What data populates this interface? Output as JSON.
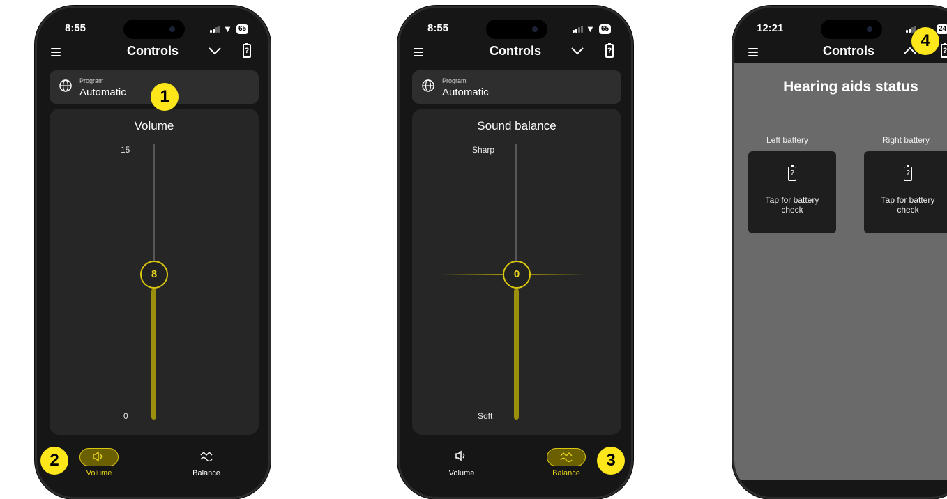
{
  "phone1": {
    "status": {
      "time": "8:55",
      "battery": "65"
    },
    "topbar": {
      "title": "Controls"
    },
    "program": {
      "label": "Program",
      "value": "Automatic"
    },
    "panel": {
      "title": "Volume",
      "top_label": "15",
      "bottom_label": "0",
      "knob_value": "8"
    },
    "tabs": [
      {
        "label": "Volume",
        "active": true
      },
      {
        "label": "Balance",
        "active": false
      }
    ]
  },
  "phone2": {
    "status": {
      "time": "8:55",
      "battery": "65"
    },
    "topbar": {
      "title": "Controls"
    },
    "program": {
      "label": "Program",
      "value": "Automatic"
    },
    "panel": {
      "title": "Sound balance",
      "top_label": "Sharp",
      "bottom_label": "Soft",
      "knob_value": "0"
    },
    "tabs": [
      {
        "label": "Volume",
        "active": false
      },
      {
        "label": "Balance",
        "active": true
      }
    ]
  },
  "phone3": {
    "status": {
      "time": "12:21",
      "battery": "24"
    },
    "topbar": {
      "title": "Controls"
    },
    "hearing": {
      "title": "Hearing aids status",
      "left_label": "Left battery",
      "right_label": "Right battery",
      "card_text_line1": "Tap for battery",
      "card_text_line2": "check",
      "icon_mark": "?"
    }
  },
  "callouts": [
    "1",
    "2",
    "3",
    "4"
  ],
  "colors": {
    "accent": "#fde71b",
    "slider_active": "#9c8f0b",
    "phone_bg": "#161616",
    "card_bg": "#262626"
  }
}
